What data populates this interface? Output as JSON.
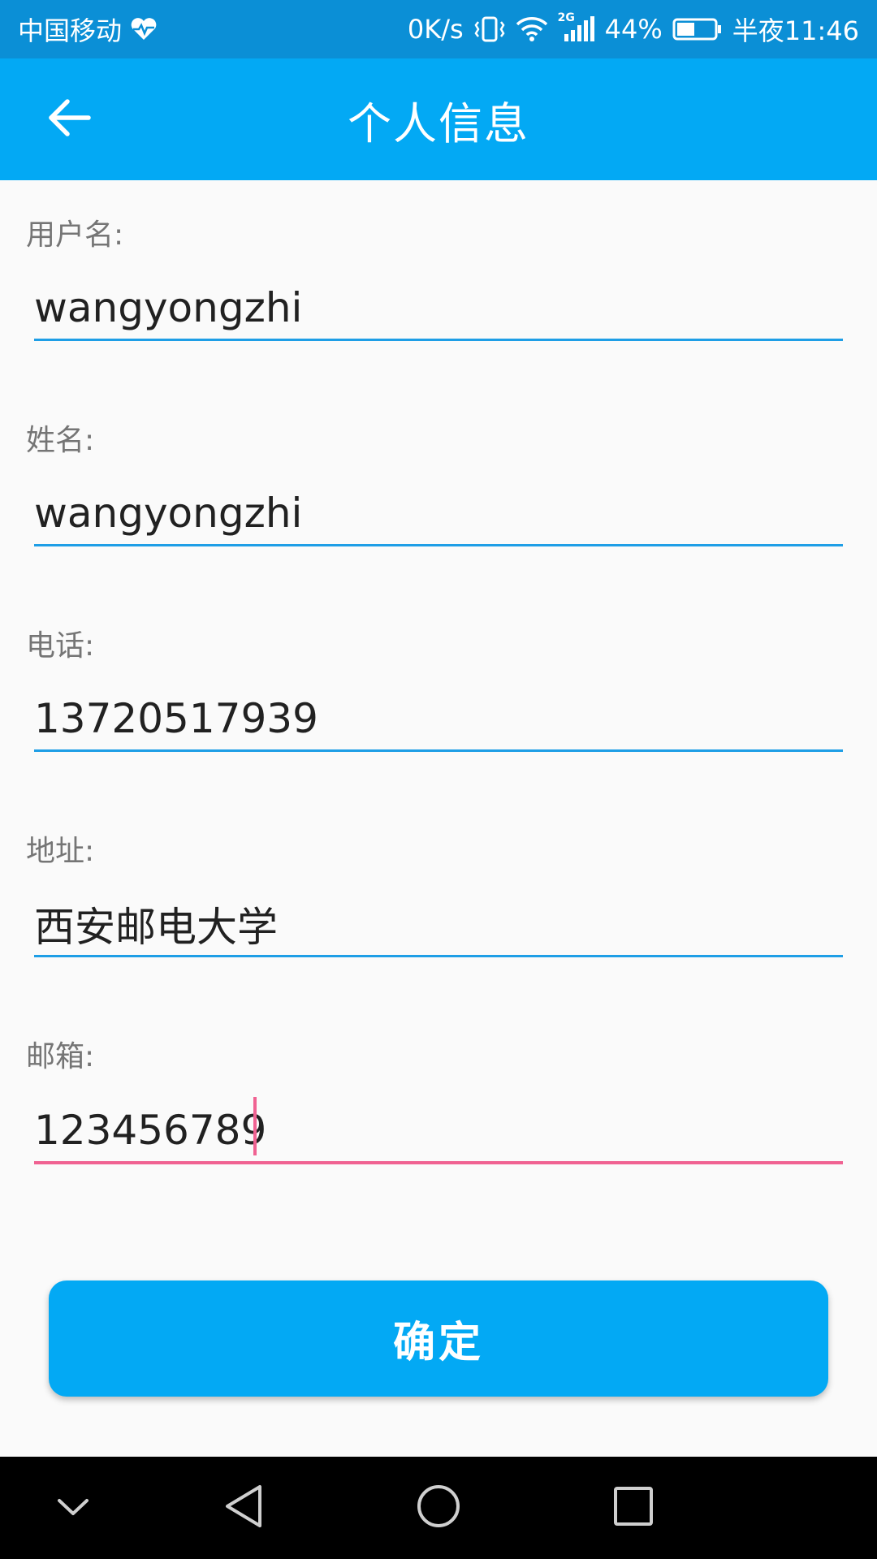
{
  "status_bar": {
    "carrier": "中国移动",
    "net_speed": "0K/s",
    "network_type": "2G",
    "battery": "44%",
    "time": "半夜11:46",
    "icons": [
      "heart-pulse-icon",
      "vibrate-icon",
      "wifi-icon",
      "signal-icon",
      "battery-icon"
    ]
  },
  "app_bar": {
    "title": "个人信息",
    "back_icon": "arrow-left-icon",
    "color": "#03a9f4"
  },
  "form": {
    "fields": [
      {
        "label": "用户名:",
        "value": "wangyongzhi"
      },
      {
        "label": "姓名:",
        "value": "wangyongzhi"
      },
      {
        "label": "电话:",
        "value": "13720517939"
      },
      {
        "label": "地址:",
        "value": "西安邮电大学"
      },
      {
        "label": "邮箱:",
        "value": "123456789",
        "focused": true
      }
    ],
    "underline_color": "#1e9ee6",
    "focus_color": "#f06292"
  },
  "confirm_button": {
    "label": "确定"
  },
  "nav_bar": {
    "icons": [
      "chevron-down-icon",
      "back-triangle-icon",
      "home-circle-icon",
      "recents-square-icon"
    ]
  }
}
